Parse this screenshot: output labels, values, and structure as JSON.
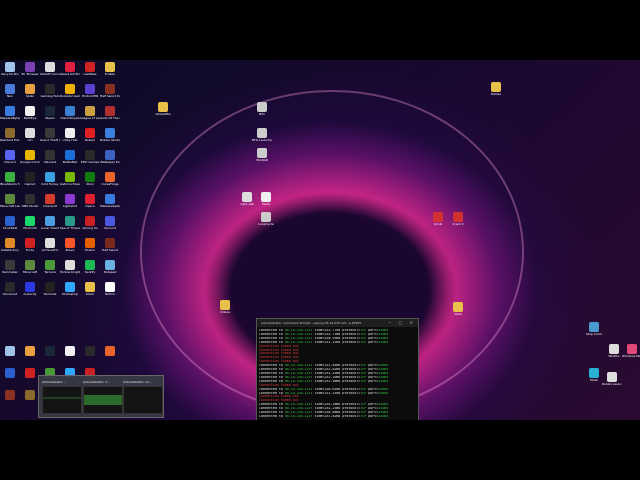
{
  "desktop_icons": [
    {
      "label": "Recycle Bin",
      "color": "#9fc4e8"
    },
    {
      "label": "Tor Browser",
      "color": "#7b3fb0"
    },
    {
      "label": "Ubisoft Connect",
      "color": "#ddd"
    },
    {
      "label": "Opera GX Browser",
      "color": "#e02040"
    },
    {
      "label": "LastPass",
      "color": "#c22"
    },
    {
      "label": "Enable",
      "color": "#e8c04a"
    },
    {
      "label": "Neo",
      "color": "#4a7bd8"
    },
    {
      "label": "Spiko",
      "color": "#e8a040"
    },
    {
      "label": "Gaming Hub",
      "color": "#2a2a2a"
    },
    {
      "label": "Rockstar Games",
      "color": "#f0b000"
    },
    {
      "label": "ProtonVPN",
      "color": "#5a3fd0"
    },
    {
      "label": "Half Sword Demo",
      "color": "#8a3020"
    },
    {
      "label": "MalwareBytes",
      "color": "#3a7be0"
    },
    {
      "label": "BattlEye",
      "color": "#f0f0f0"
    },
    {
      "label": "Steam",
      "color": "#1b2838"
    },
    {
      "label": "Clash Royale",
      "color": "#3a80d0"
    },
    {
      "label": "League of Legends",
      "color": "#c8a040"
    },
    {
      "label": "Gods Of The Forest",
      "color": "#b03030"
    },
    {
      "label": "Resident Evil Village",
      "color": "#8a6a2a"
    },
    {
      "label": "ctrl",
      "color": "#ddd"
    },
    {
      "label": "Grand Theft Auto V",
      "color": "#3a3a3a"
    },
    {
      "label": "Unity Hub",
      "color": "#eee"
    },
    {
      "label": "Roblox",
      "color": "#e02020"
    },
    {
      "label": "Roblox Studio",
      "color": "#3a80e0"
    },
    {
      "label": "Discord",
      "color": "#5865f2"
    },
    {
      "label": "Google Chrome",
      "color": "#e8b800"
    },
    {
      "label": "Valorant",
      "color": "#333"
    },
    {
      "label": "BattleNet",
      "color": "#1a6ed8"
    },
    {
      "label": "EPIC Games",
      "color": "#2a2a2a"
    },
    {
      "label": "Wallpaper Engine",
      "color": "#3a60c0"
    },
    {
      "label": "BlueStacks 5",
      "color": "#3ab040"
    },
    {
      "label": "CapCut",
      "color": "#222"
    },
    {
      "label": "Cold Turkey",
      "color": "#3aa0e0"
    },
    {
      "label": "Geforce Experience",
      "color": "#76b900"
    },
    {
      "label": "Xbox",
      "color": "#107c10"
    },
    {
      "label": "CurseForge",
      "color": "#e8642a"
    },
    {
      "label": "Minecraft Launcher",
      "color": "#5a8a3a"
    },
    {
      "label": "OBS Studio",
      "color": "#302e31"
    },
    {
      "label": "Overwolf",
      "color": "#d23a2a"
    },
    {
      "label": "Lightshot",
      "color": "#8a3ad0"
    },
    {
      "label": "Opera",
      "color": "#e02030"
    },
    {
      "label": "Malwarebytes",
      "color": "#3a7be0"
    },
    {
      "label": "VirusTotal",
      "color": "#2a60d0"
    },
    {
      "label": "Modrinth",
      "color": "#1bd96a"
    },
    {
      "label": "Lunar Client",
      "color": "#4aa0e0"
    },
    {
      "label": "Sea of Thieves",
      "color": "#2a9a8a"
    },
    {
      "label": "Among Us",
      "color": "#c82020"
    },
    {
      "label": "Vencord",
      "color": "#4a5ae0"
    },
    {
      "label": "Satisfactory",
      "color": "#e08a2a"
    },
    {
      "label": "Forza",
      "color": "#d02020"
    },
    {
      "label": "ArchiveTrix",
      "color": "#ddd"
    },
    {
      "label": "Brave",
      "color": "#fb542b"
    },
    {
      "label": "Firefox",
      "color": "#e66000"
    },
    {
      "label": "Half Sword",
      "color": "#7a2a1a"
    },
    {
      "label": "Rainmeter",
      "color": "#3a3a3a"
    },
    {
      "label": "Minecraft",
      "color": "#5a8a3a"
    },
    {
      "label": "Terraria",
      "color": "#4a9a3a"
    },
    {
      "label": "Hollow Knight",
      "color": "#ddd"
    },
    {
      "label": "Spotify",
      "color": "#1db954"
    },
    {
      "label": "Notepad",
      "color": "#6ab0e0"
    },
    {
      "label": "Voicemod",
      "color": "#2a2a2a"
    },
    {
      "label": "Audacity",
      "color": "#2a3ae0"
    },
    {
      "label": "Terminal",
      "color": "#222"
    },
    {
      "label": "Photoshop",
      "color": "#31a8ff"
    },
    {
      "label": "Klack",
      "color": "#e8c04a"
    },
    {
      "label": "Notion",
      "color": "#fff"
    }
  ],
  "right_icons": [
    {
      "label": "Dailies",
      "color": "#e8c04a"
    },
    {
      "label": "AdobePSA",
      "color": "#e8c04a"
    },
    {
      "label": "Bits",
      "color": "#ccc"
    },
    {
      "label": "BFG Launcher",
      "color": "#ccc"
    },
    {
      "label": "WinRAR",
      "color": "#ccc"
    },
    {
      "label": "right_bat",
      "color": "#ddd"
    },
    {
      "label": "Mods",
      "color": "#eee"
    },
    {
      "label": "LoopCycle",
      "color": "#ccc"
    },
    {
      "label": "Scrub",
      "color": "#d03030"
    },
    {
      "label": "Crack 2",
      "color": "#d03030"
    },
    {
      "label": "Videos",
      "color": "#e8c04a"
    },
    {
      "label": "Vetal",
      "color": "#e8c04a"
    },
    {
      "label": "Stop Clock",
      "color": "#4a9ad0"
    },
    {
      "label": "WinDLL",
      "color": "#ddd"
    },
    {
      "label": "Windows Media Player",
      "color": "#e04a7a"
    },
    {
      "label": "Mosk",
      "color": "#2ab0d0"
    },
    {
      "label": "Roblox Launcher",
      "color": "#ddd"
    }
  ],
  "console": {
    "title": "Administrator: Command Prompt - paping 95.14.235.121 -p 25565",
    "lines": [
      {
        "type": "ok",
        "text": "Connected to ",
        "ip": "95.14.235.121",
        "rest": ": time=252.77ms protocol=",
        "proto": "TCP",
        "port_label": " port=",
        "port": "25565"
      },
      {
        "type": "ok",
        "text": "Connected to ",
        "ip": "95.14.235.121",
        "rest": ": time=252.73ms protocol=",
        "proto": "TCP",
        "port_label": " port=",
        "port": "25565"
      },
      {
        "type": "ok",
        "text": "Connected to ",
        "ip": "95.14.235.121",
        "rest": ": time=250.93ms protocol=",
        "proto": "TCP",
        "port_label": " port=",
        "port": "25565"
      },
      {
        "type": "ok",
        "text": "Connected to ",
        "ip": "95.14.235.121",
        "rest": ": time=251.13ms protocol=",
        "proto": "TCP",
        "port_label": " port=",
        "port": "25565"
      },
      {
        "type": "err",
        "text": "Connection timed out"
      },
      {
        "type": "err",
        "text": "Connection timed out"
      },
      {
        "type": "err",
        "text": "Connection timed out"
      },
      {
        "type": "err",
        "text": "Connection timed out"
      },
      {
        "type": "err",
        "text": "Connection timed out"
      },
      {
        "type": "ok",
        "text": "Connected to ",
        "ip": "95.14.235.121",
        "rest": ": time=251.85ms protocol=",
        "proto": "TCP",
        "port_label": " port=",
        "port": "25565"
      },
      {
        "type": "ok",
        "text": "Connected to ",
        "ip": "95.14.235.121",
        "rest": ": time=252.02ms protocol=",
        "proto": "TCP",
        "port_label": " port=",
        "port": "25565"
      },
      {
        "type": "ok",
        "text": "Connected to ",
        "ip": "95.14.235.121",
        "rest": ": time=252.53ms protocol=",
        "proto": "TCP",
        "port_label": " port=",
        "port": "25565"
      },
      {
        "type": "ok",
        "text": "Connected to ",
        "ip": "95.14.235.121",
        "rest": ": time=252.20ms protocol=",
        "proto": "TCP",
        "port_label": " port=",
        "port": "25565"
      },
      {
        "type": "ok",
        "text": "Connected to ",
        "ip": "95.14.235.121",
        "rest": ": time=251.96ms protocol=",
        "proto": "TCP",
        "port_label": " port=",
        "port": "25565"
      },
      {
        "type": "err",
        "text": "Connection timed out"
      },
      {
        "type": "ok",
        "text": "Connected to ",
        "ip": "95.14.235.121",
        "rest": ": time=250.61ms protocol=",
        "proto": "TCP",
        "port_label": " port=",
        "port": "25565"
      },
      {
        "type": "ok",
        "text": "Connected to ",
        "ip": "95.14.235.121",
        "rest": ": time=251.31ms protocol=",
        "proto": "TCP",
        "port_label": " port=",
        "port": "25565"
      },
      {
        "type": "err",
        "text": "Connection timed out"
      },
      {
        "type": "err",
        "text": "Connection timed out"
      },
      {
        "type": "ok",
        "text": "Connected to ",
        "ip": "95.14.235.121",
        "rest": ": time=254.28ms protocol=",
        "proto": "TCP",
        "port_label": " port=",
        "port": "25565"
      },
      {
        "type": "ok",
        "text": "Connected to ",
        "ip": "95.14.235.121",
        "rest": ": time=252.23ms protocol=",
        "proto": "TCP",
        "port_label": " port=",
        "port": "25565"
      },
      {
        "type": "ok",
        "text": "Connected to ",
        "ip": "95.14.235.121",
        "rest": ": time=250.88ms protocol=",
        "proto": "TCP",
        "port_label": " port=",
        "port": "25565"
      },
      {
        "type": "ok",
        "text": "Connected to ",
        "ip": "95.14.235.121",
        "rest": ": time=251.62ms protocol=",
        "proto": "TCP",
        "port_label": " port=",
        "port": "25565"
      }
    ]
  },
  "taskbar_popup": {
    "thumbs": [
      {
        "title": "Administrator: ..."
      },
      {
        "title": "Administrator: C..."
      },
      {
        "title": "Administrator: Co..."
      }
    ]
  }
}
